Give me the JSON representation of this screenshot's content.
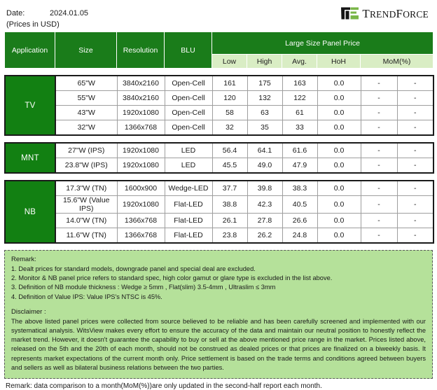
{
  "header": {
    "date_label": "Date:",
    "date_value": "2024.01.05",
    "currency_note": "(Prices in USD)",
    "logo_text_1": "T",
    "logo_text_2": "REND",
    "logo_text_3": "F",
    "logo_text_4": "ORCE",
    "logo_name": "TrendForce",
    "logo_black": "#151515",
    "logo_green": "#7ab648"
  },
  "colors": {
    "header_dark_green": "#1a7c1a",
    "header_light_green": "#d9edc4",
    "category_green": "#128012",
    "notes_green": "#b5e19a"
  },
  "table": {
    "columns": [
      "Application",
      "Size",
      "Resolution",
      "BLU"
    ],
    "group_header": "Large Size Panel Price",
    "sub_columns": [
      "Low",
      "High",
      "Avg.",
      "HoH",
      "MoM(%)"
    ],
    "groups": [
      {
        "category": "TV",
        "rows": [
          {
            "size": "65\"W",
            "resolution": "3840x2160",
            "blu": "Open-Cell",
            "low": "161",
            "high": "175",
            "avg": "163",
            "hoh": "0.0",
            "mom1": "-",
            "mom2": "-"
          },
          {
            "size": "55\"W",
            "resolution": "3840x2160",
            "blu": "Open-Cell",
            "low": "120",
            "high": "132",
            "avg": "122",
            "hoh": "0.0",
            "mom1": "-",
            "mom2": "-"
          },
          {
            "size": "43\"W",
            "resolution": "1920x1080",
            "blu": "Open-Cell",
            "low": "58",
            "high": "63",
            "avg": "61",
            "hoh": "0.0",
            "mom1": "-",
            "mom2": "-"
          },
          {
            "size": "32\"W",
            "resolution": "1366x768",
            "blu": "Open-Cell",
            "low": "32",
            "high": "35",
            "avg": "33",
            "hoh": "0.0",
            "mom1": "-",
            "mom2": "-"
          }
        ]
      },
      {
        "category": "MNT",
        "rows": [
          {
            "size": "27\"W (IPS)",
            "resolution": "1920x1080",
            "blu": "LED",
            "low": "56.4",
            "high": "64.1",
            "avg": "61.6",
            "hoh": "0.0",
            "mom1": "-",
            "mom2": "-"
          },
          {
            "size": "23.8\"W (IPS)",
            "resolution": "1920x1080",
            "blu": "LED",
            "low": "45.5",
            "high": "49.0",
            "avg": "47.9",
            "hoh": "0.0",
            "mom1": "-",
            "mom2": "-"
          }
        ]
      },
      {
        "category": "NB",
        "rows": [
          {
            "size": "17.3\"W (TN)",
            "resolution": "1600x900",
            "blu": "Wedge-LED",
            "low": "37.7",
            "high": "39.8",
            "avg": "38.3",
            "hoh": "0.0",
            "mom1": "-",
            "mom2": "-"
          },
          {
            "size": "15.6\"W (Value IPS)",
            "resolution": "1920x1080",
            "blu": "Flat-LED",
            "low": "38.8",
            "high": "42.3",
            "avg": "40.5",
            "hoh": "0.0",
            "mom1": "-",
            "mom2": "-"
          },
          {
            "size": "14.0\"W (TN)",
            "resolution": "1366x768",
            "blu": "Flat-LED",
            "low": "26.1",
            "high": "27.8",
            "avg": "26.6",
            "hoh": "0.0",
            "mom1": "-",
            "mom2": "-"
          },
          {
            "size": "11.6\"W (TN)",
            "resolution": "1366x768",
            "blu": "Flat-LED",
            "low": "23.8",
            "high": "26.2",
            "avg": "24.8",
            "hoh": "0.0",
            "mom1": "-",
            "mom2": "-"
          }
        ]
      }
    ]
  },
  "notes": {
    "remark_title": "Remark:",
    "remark_lines": [
      "1. Dealt prices for standard models, downgrade panel and special deal are excluded.",
      "2. Monitor & NB panel price refers to standard spec, high color gamut or glare type is excluded in the list above.",
      "3. Definition of NB module thickness : Wedge ≥ 5mm , Flat(slim) 3.5-4mm , Ultraslim ≤ 3mm",
      "4. Definition of Value IPS: Value IPS's NTSC is 45%."
    ],
    "disclaimer_title": "Disclaimer :",
    "disclaimer_text": "The above listed panel prices were collected from source believed to be reliable and has been carefully screened and implemented with our systematical analysis. WitsView makes every effort to ensure the accuracy of the data and maintain our neutral position to honestly reflect the market trend. However, it doesn't guarantee the capability to buy or sell at the above mentioned price range in the market. Prices listed above, released on the 5th and the 20th of each month, should not be construed as dealed prices or that prices are finalized on a biweekly basis. It represents market expectations of the current month only. Price settlement is based on the trade terms and conditions agreed between buyers and sellers as well as bilateral business relations between the two parties."
  },
  "footer": {
    "remark": "Remark: data comparison to a month(MoM(%))are only updated in the second-half report each month."
  }
}
